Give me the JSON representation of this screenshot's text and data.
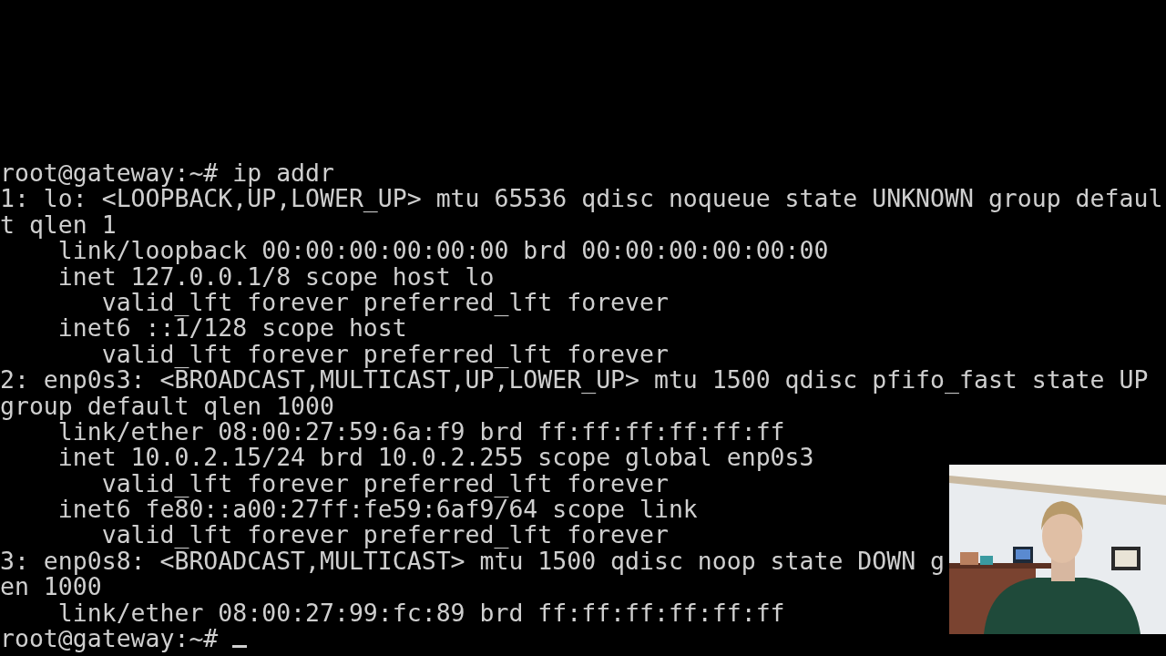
{
  "terminal": {
    "lines": [
      "root@gateway:~# ip addr",
      "1: lo: <LOOPBACK,UP,LOWER_UP> mtu 65536 qdisc noqueue state UNKNOWN group defaul",
      "t qlen 1",
      "    link/loopback 00:00:00:00:00:00 brd 00:00:00:00:00:00",
      "    inet 127.0.0.1/8 scope host lo",
      "       valid_lft forever preferred_lft forever",
      "    inet6 ::1/128 scope host",
      "       valid_lft forever preferred_lft forever",
      "2: enp0s3: <BROADCAST,MULTICAST,UP,LOWER_UP> mtu 1500 qdisc pfifo_fast state UP",
      "group default qlen 1000",
      "    link/ether 08:00:27:59:6a:f9 brd ff:ff:ff:ff:ff:ff",
      "    inet 10.0.2.15/24 brd 10.0.2.255 scope global enp0s3",
      "       valid_lft forever preferred_lft forever",
      "    inet6 fe80::a00:27ff:fe59:6af9/64 scope link",
      "       valid_lft forever preferred_lft forever",
      "3: enp0s8: <BROADCAST,MULTICAST> mtu 1500 qdisc noop state DOWN g",
      "en 1000",
      "    link/ether 08:00:27:99:fc:89 brd ff:ff:ff:ff:ff:ff"
    ],
    "prompt": "root@gateway:~# "
  }
}
